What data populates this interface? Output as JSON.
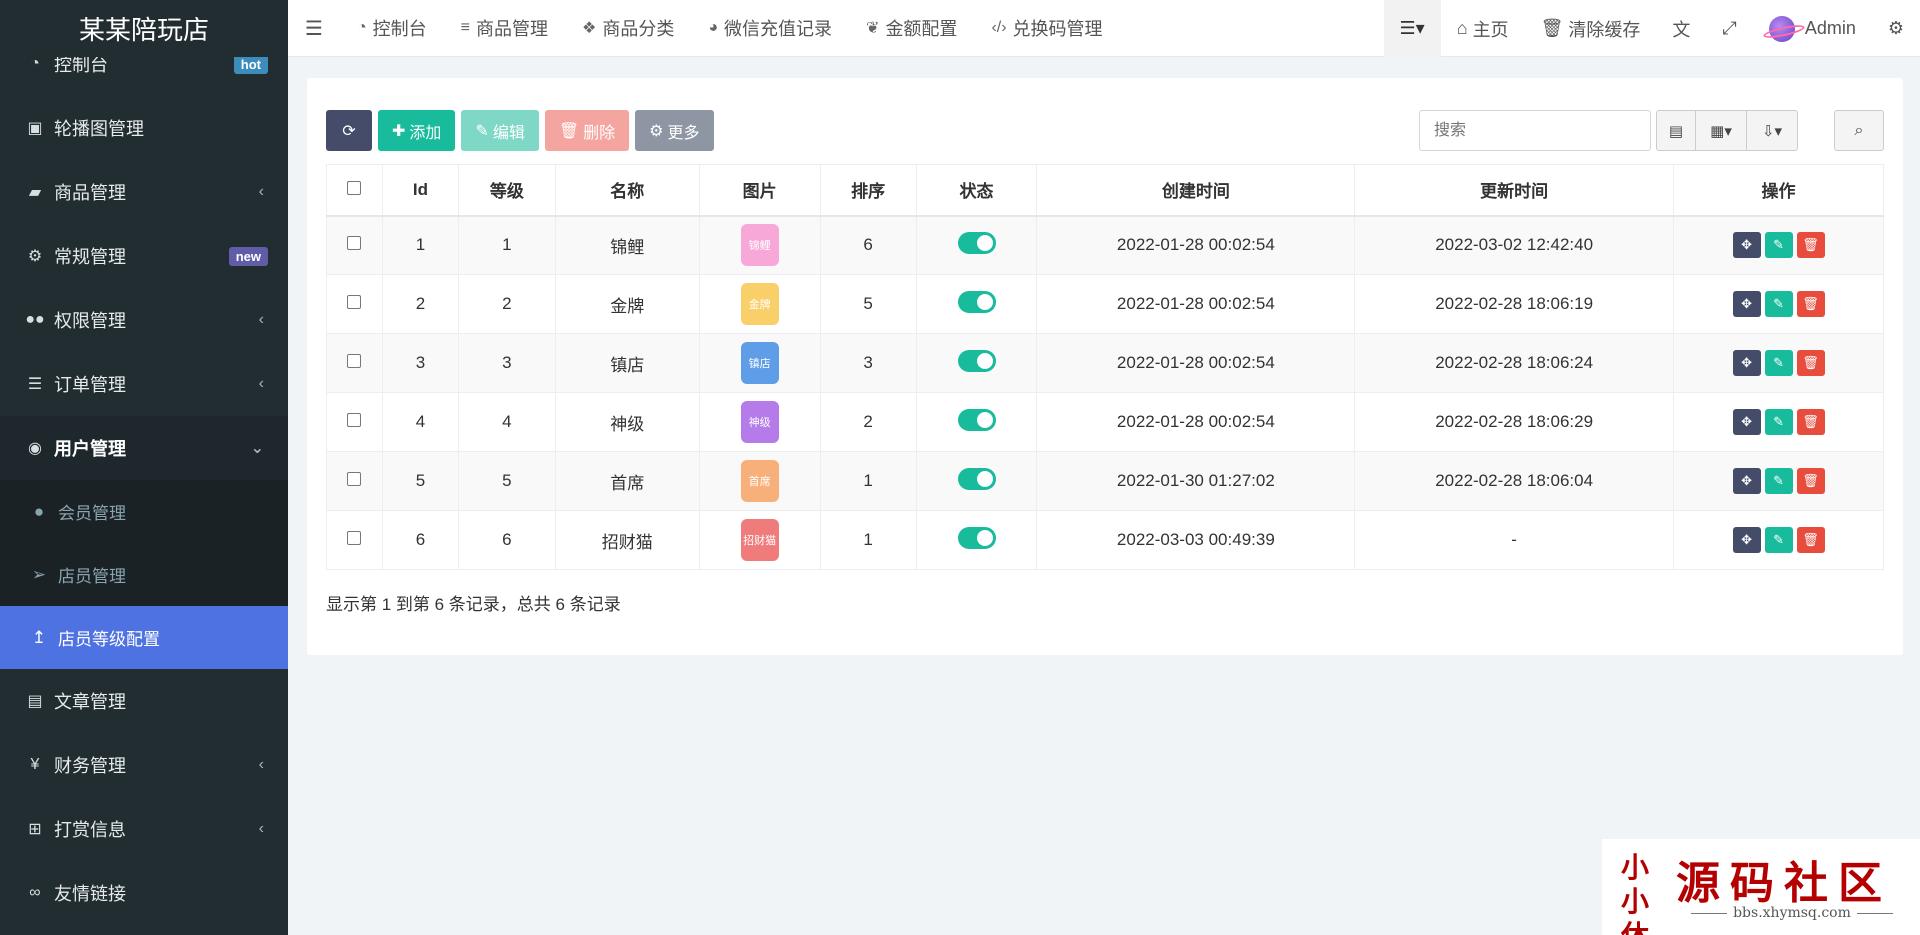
{
  "app": {
    "title": "某某陪玩店"
  },
  "sidebar": {
    "items": [
      {
        "label": "控制台",
        "icon": "dashboard-icon",
        "badge": "hot"
      },
      {
        "label": "轮播图管理",
        "icon": "image-icon"
      },
      {
        "label": "商品管理",
        "icon": "book-icon",
        "chevron": "‹"
      },
      {
        "label": "常规管理",
        "icon": "gears-icon",
        "badge": "new"
      },
      {
        "label": "权限管理",
        "icon": "users-icon",
        "chevron": "‹"
      },
      {
        "label": "订单管理",
        "icon": "list-icon",
        "chevron": "‹"
      },
      {
        "label": "用户管理",
        "icon": "user-circle-icon",
        "chevron": "⌄"
      },
      {
        "label": "文章管理",
        "icon": "newspaper-icon"
      },
      {
        "label": "财务管理",
        "icon": "yen-icon",
        "chevron": "‹"
      },
      {
        "label": "打赏信息",
        "icon": "gift-icon",
        "chevron": "‹"
      },
      {
        "label": "友情链接",
        "icon": "link-icon"
      }
    ],
    "submenu": [
      {
        "label": "会员管理",
        "icon": "user-icon"
      },
      {
        "label": "店员管理",
        "icon": "paper-plane-icon"
      },
      {
        "label": "店员等级配置",
        "icon": "level-up-icon"
      }
    ]
  },
  "topbar": {
    "nav": [
      {
        "label": "控制台",
        "icon": "dashboard-icon"
      },
      {
        "label": "商品管理",
        "icon": "bars-icon"
      },
      {
        "label": "商品分类",
        "icon": "cubes-icon"
      },
      {
        "label": "微信充值记录",
        "icon": "wechat-icon"
      },
      {
        "label": "金额配置",
        "icon": "leaf-icon"
      },
      {
        "label": "兑换码管理",
        "icon": "code-icon"
      }
    ],
    "right": {
      "home_label": "主页",
      "clear_cache_label": "清除缓存",
      "user_name": "Admin"
    }
  },
  "toolbar": {
    "add_label": "添加",
    "edit_label": "编辑",
    "delete_label": "删除",
    "more_label": "更多",
    "search_placeholder": "搜索"
  },
  "table": {
    "headers": [
      "Id",
      "等级",
      "名称",
      "图片",
      "排序",
      "状态",
      "创建时间",
      "更新时间",
      "操作"
    ],
    "rows": [
      {
        "id": "1",
        "level": "1",
        "name": "锦鲤",
        "image_text": "锦鲤",
        "image_color": "#f7a8d9",
        "sort": "6",
        "status": true,
        "created": "2022-01-28 00:02:54",
        "updated": "2022-03-02 12:42:40"
      },
      {
        "id": "2",
        "level": "2",
        "name": "金牌",
        "image_text": "金牌",
        "image_color": "#f9cf6a",
        "sort": "5",
        "status": true,
        "created": "2022-01-28 00:02:54",
        "updated": "2022-02-28 18:06:19"
      },
      {
        "id": "3",
        "level": "3",
        "name": "镇店",
        "image_text": "镇店",
        "image_color": "#5f9de8",
        "sort": "3",
        "status": true,
        "created": "2022-01-28 00:02:54",
        "updated": "2022-02-28 18:06:24"
      },
      {
        "id": "4",
        "level": "4",
        "name": "神级",
        "image_text": "神级",
        "image_color": "#b57be8",
        "sort": "2",
        "status": true,
        "created": "2022-01-28 00:02:54",
        "updated": "2022-02-28 18:06:29"
      },
      {
        "id": "5",
        "level": "5",
        "name": "首席",
        "image_text": "首席",
        "image_color": "#f8b07a",
        "sort": "1",
        "status": true,
        "created": "2022-01-30 01:27:02",
        "updated": "2022-02-28 18:06:04"
      },
      {
        "id": "6",
        "level": "6",
        "name": "招财猫",
        "image_text": "招财猫",
        "image_color": "#f07b7b",
        "sort": "1",
        "status": true,
        "created": "2022-03-03 00:49:39",
        "updated": "-"
      }
    ]
  },
  "pagination": {
    "summary": "显示第 1 到第 6 条记录，总共 6 条记录"
  },
  "watermark": {
    "seal": "小小休",
    "title": "源码社区",
    "url": "bbs.xhymsq.com"
  },
  "colors": {
    "sidebar_bg": "#222d32",
    "active_blue": "#4e72e2",
    "success": "#18bc9c",
    "danger": "#e74c3c",
    "dark": "#444c69"
  }
}
